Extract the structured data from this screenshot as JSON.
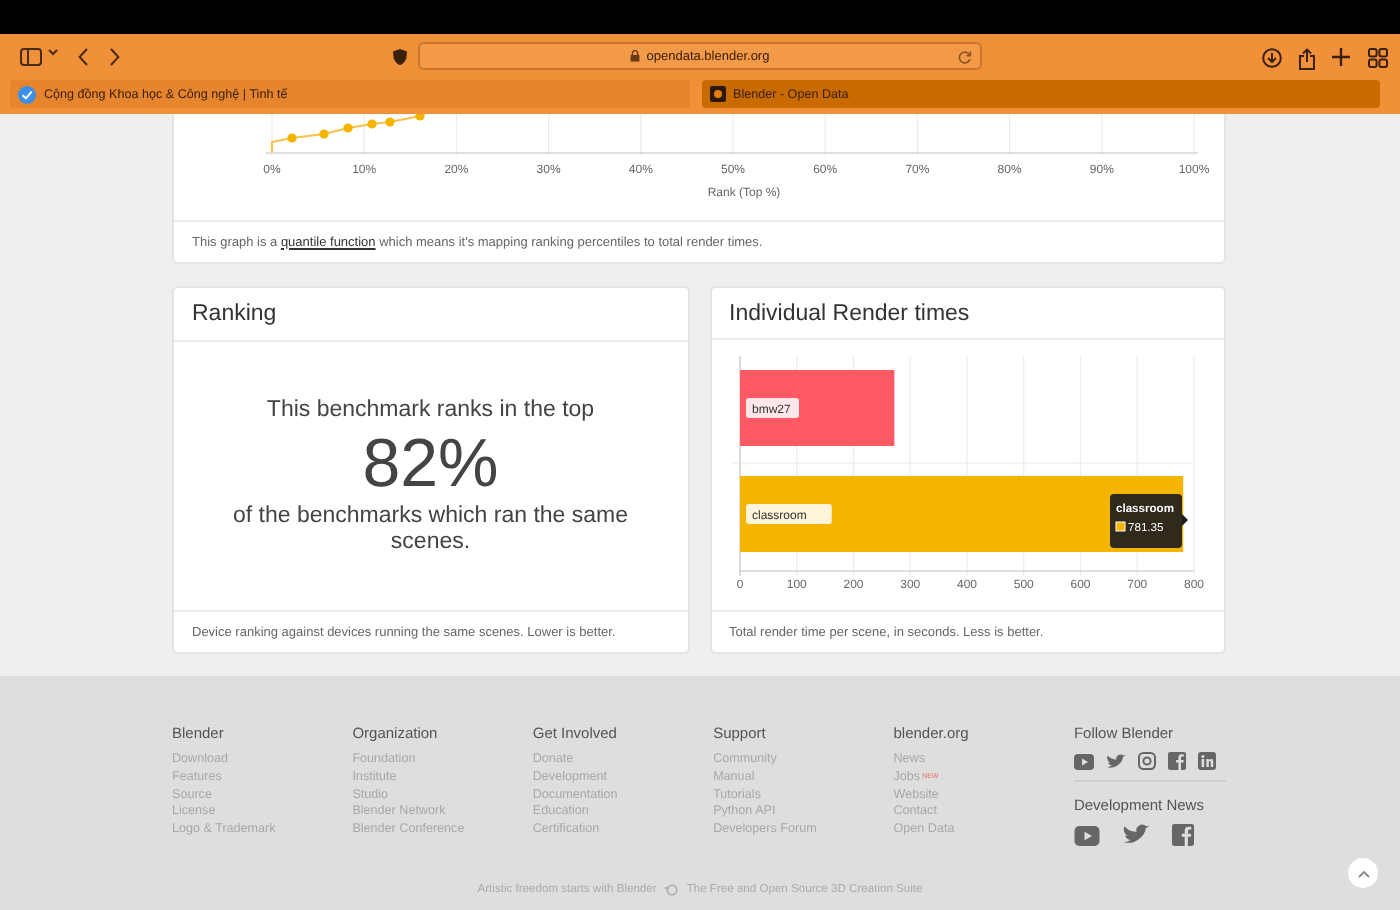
{
  "browser": {
    "url": "opendata.blender.org",
    "tabs": [
      {
        "title": "Cộng đồng Khoa học & Công nghệ | Tinh tế",
        "kind": "site",
        "selected": false
      },
      {
        "title": "Blender - Open Data",
        "kind": "blender",
        "selected": true
      }
    ]
  },
  "quantile_card": {
    "x_ticks": [
      "0%",
      "10%",
      "20%",
      "30%",
      "40%",
      "50%",
      "60%",
      "70%",
      "80%",
      "90%",
      "100%"
    ],
    "x_label": "Rank (Top %)",
    "caption_before": "This graph is a",
    "caption_link": "quantile function",
    "caption_after": "which means it's mapping ranking percentiles to total render times."
  },
  "ranking_card": {
    "title": "Ranking",
    "lead": "This benchmark ranks in the top",
    "value": "82%",
    "trail": "of the benchmarks which ran the same scenes.",
    "footer": "Device ranking against devices running the same scenes. Lower is better."
  },
  "render_card": {
    "title": "Individual Render times",
    "footer": "Total render time per scene, in seconds. Less is better.",
    "chart_data": {
      "type": "bar",
      "orientation": "horizontal",
      "grid": true,
      "categories": [
        "bmw27",
        "classroom"
      ],
      "series": [
        {
          "color": "#ff5a64",
          "values": [
            272,
            null
          ]
        },
        {
          "color": "#f5b400",
          "values": [
            null,
            781
          ]
        }
      ],
      "xlim": [
        0,
        800
      ],
      "xticks": [
        0,
        100,
        200,
        300,
        400,
        500,
        600,
        700,
        800
      ]
    },
    "tooltip": {
      "title": "classroom",
      "value": "781.35"
    }
  },
  "footer": {
    "columns": [
      {
        "heading": "Blender",
        "links": [
          {
            "label": "Download"
          },
          {
            "label": "Features"
          },
          {
            "label": "Source"
          },
          {
            "label": "License"
          },
          {
            "label": "Logo & Trademark"
          }
        ]
      },
      {
        "heading": "Organization",
        "links": [
          {
            "label": "Foundation"
          },
          {
            "label": "Institute"
          },
          {
            "label": "Studio"
          },
          {
            "label": "Blender Network"
          },
          {
            "label": "Blender Conference"
          }
        ]
      },
      {
        "heading": "Get Involved",
        "links": [
          {
            "label": "Donate"
          },
          {
            "label": "Development"
          },
          {
            "label": "Documentation"
          },
          {
            "label": "Education"
          },
          {
            "label": "Certification"
          }
        ]
      },
      {
        "heading": "Support",
        "links": [
          {
            "label": "Community"
          },
          {
            "label": "Manual"
          },
          {
            "label": "Tutorials"
          },
          {
            "label": "Python API"
          },
          {
            "label": "Developers Forum"
          }
        ]
      },
      {
        "heading": "blender.org",
        "links": [
          {
            "label": "News"
          },
          {
            "label": "Jobs",
            "badge": "NEW"
          },
          {
            "label": "Website"
          },
          {
            "label": "Contact"
          },
          {
            "label": "Open Data"
          }
        ]
      }
    ],
    "follow_heading": "Follow Blender",
    "dev_news_heading": "Development News",
    "tagline": "Artistic freedom starts with Blender",
    "tagline_2": "The Free and Open Source 3D Creation Suite"
  }
}
